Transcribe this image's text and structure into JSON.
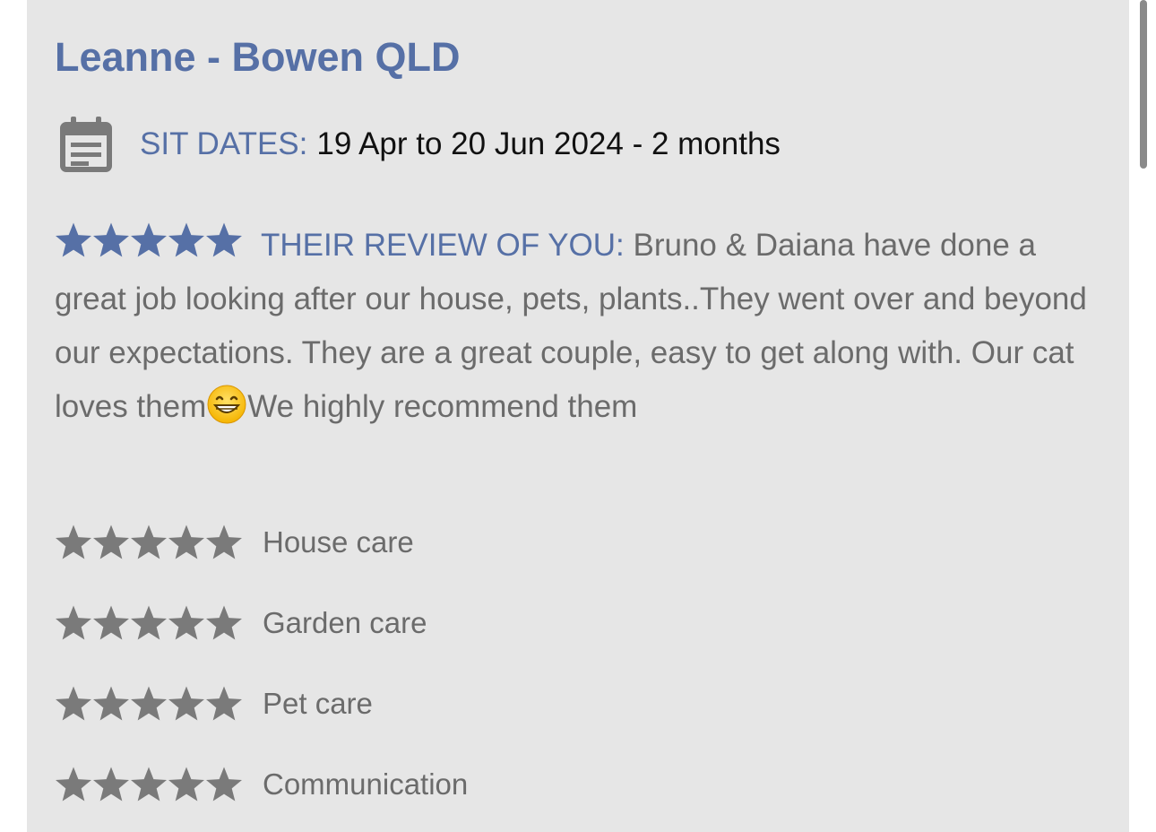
{
  "review_card": {
    "title": "Leanne - Bowen QLD",
    "sit_dates": {
      "icon": "calendar-icon",
      "label": "SIT DATES:",
      "value": "19 Apr to 20 Jun 2024 - 2 months"
    },
    "review": {
      "rating": 5,
      "rating_max": 5,
      "label": "THEIR REVIEW OF YOU:",
      "text_before_emoji": " Bruno & Daiana have done a great job looking after our house, pets, plants..They went over and beyond our expectations. They are a great couple, easy to get along with. Our cat loves them",
      "emoji": "grinning-face-emoji",
      "text_after_emoji": "We highly recommend them"
    },
    "category_ratings": [
      {
        "label": "House care",
        "rating": 5
      },
      {
        "label": "Garden care",
        "rating": 5
      },
      {
        "label": "Pet care",
        "rating": 5
      },
      {
        "label": "Communication",
        "rating": 5
      }
    ]
  },
  "colors": {
    "accent_blue": "#5670a6",
    "star_blue": "#5670a6",
    "star_gray": "#7a7a7a",
    "card_bg": "#e6e6e6",
    "body_text": "#6b6b6b"
  }
}
